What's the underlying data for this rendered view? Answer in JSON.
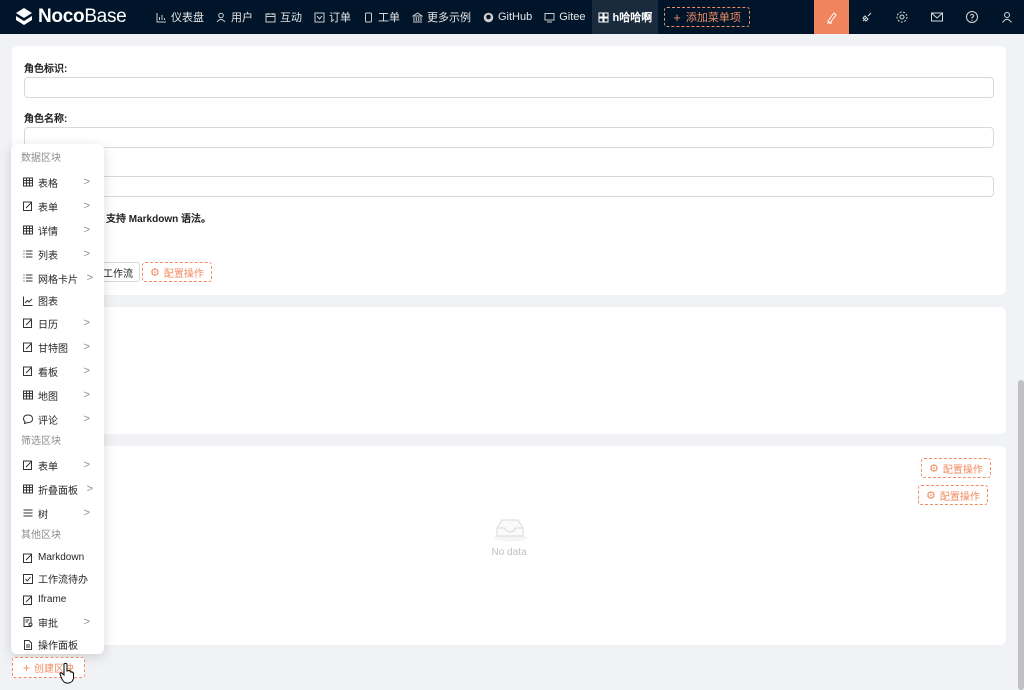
{
  "app": {
    "logo_text_a": "Noco",
    "logo_text_b": "Base",
    "nav": [
      {
        "label": "仪表盘",
        "icon": "bar-chart-icon"
      },
      {
        "label": "用户",
        "icon": "user-icon"
      },
      {
        "label": "互动",
        "icon": "calendar-icon"
      },
      {
        "label": "订单",
        "icon": "tag-icon"
      },
      {
        "label": "工单",
        "icon": "copy-icon"
      },
      {
        "label": "更多示例",
        "icon": "bank-icon"
      },
      {
        "label": "GitHub",
        "icon": "github-icon"
      },
      {
        "label": "Gitee",
        "icon": "monitor-icon"
      },
      {
        "label": "h哈哈啊",
        "icon": "grid-icon"
      }
    ],
    "add_menu_label": "添加菜单项",
    "accent": "#f0845e"
  },
  "form": {
    "role_id_label": "角色标识:",
    "role_name_label": "角色名称:",
    "markdown_hint": "示，支持 Markdown 语法。",
    "workflow_btn": "工作流",
    "config_action": "配置操作"
  },
  "table_block": {
    "config_action_1": "配置操作",
    "config_action_2": "配置操作",
    "empty": "No data"
  },
  "dropdown": {
    "group_data": "数据区块",
    "data_items": [
      {
        "label": "表格",
        "icon": "table-icon",
        "sub": true
      },
      {
        "label": "表单",
        "icon": "form-icon",
        "sub": true
      },
      {
        "label": "详情",
        "icon": "table-icon",
        "sub": true
      },
      {
        "label": "列表",
        "icon": "list-icon",
        "sub": true
      },
      {
        "label": "网格卡片",
        "icon": "list-icon",
        "sub": true
      },
      {
        "label": "图表",
        "icon": "line-chart-icon",
        "sub": false
      },
      {
        "label": "日历",
        "icon": "form-icon",
        "sub": true
      },
      {
        "label": "甘特图",
        "icon": "form-icon",
        "sub": true
      },
      {
        "label": "看板",
        "icon": "form-icon",
        "sub": true
      },
      {
        "label": "地图",
        "icon": "table-icon",
        "sub": true
      },
      {
        "label": "评论",
        "icon": "comment-icon",
        "sub": true
      }
    ],
    "group_filter": "筛选区块",
    "filter_items": [
      {
        "label": "表单",
        "icon": "form-icon",
        "sub": true
      },
      {
        "label": "折叠面板",
        "icon": "table-icon",
        "sub": true
      },
      {
        "label": "树",
        "icon": "menu-icon",
        "sub": true
      }
    ],
    "group_other": "其他区块",
    "other_items": [
      {
        "label": "Markdown",
        "icon": "form-icon",
        "sub": false
      },
      {
        "label": "工作流待办",
        "icon": "check-square-icon",
        "sub": false
      },
      {
        "label": "Iframe",
        "icon": "form-icon",
        "sub": false
      },
      {
        "label": "审批",
        "icon": "audit-icon",
        "sub": true
      },
      {
        "label": "操作面板",
        "icon": "file-icon",
        "sub": false
      }
    ]
  },
  "create_block": "创建区块"
}
